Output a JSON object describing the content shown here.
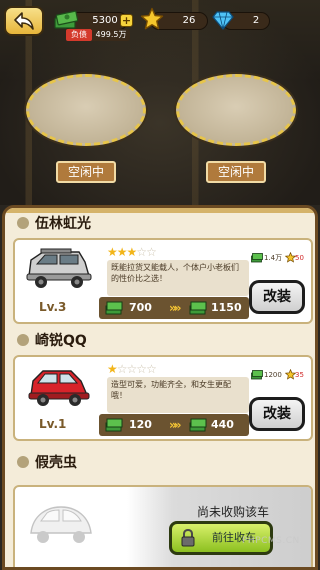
{
  "header": {
    "cash": "5300",
    "stars": "26",
    "gems": "2",
    "debt_label": "负债",
    "debt_value": "499.5万"
  },
  "platforms": [
    {
      "status": "空闲中"
    },
    {
      "status": "空闲中"
    }
  ],
  "cars": [
    {
      "name": "伍林虹光",
      "level": "Lv.3",
      "rating": 3,
      "max_rating": 5,
      "description": "既能拉货又能载人，个体户小老板们的性价比之选！",
      "current_value": "700",
      "upgrade_value": "1150",
      "stat_cash": "1.4万",
      "stat_stars": "50",
      "action": "改装",
      "color": "#c9c9c9"
    },
    {
      "name": "崎锐QQ",
      "level": "Lv.1",
      "rating": 1,
      "max_rating": 5,
      "description": "造型可爱，功能齐全，和女生更配哦！",
      "current_value": "120",
      "upgrade_value": "440",
      "stat_cash": "1200",
      "stat_stars": "35",
      "action": "改装",
      "color": "#d8232a"
    },
    {
      "name": "假壳虫",
      "locked": true,
      "status": "尚未收购该车",
      "action": "前往收车",
      "color": "#bdbdbd"
    }
  ],
  "watermark": "PHPCMS.CN",
  "colors": {
    "accent_green": "#8cc020",
    "star": "#f2b51a",
    "debt_red": "#d43a2c"
  }
}
